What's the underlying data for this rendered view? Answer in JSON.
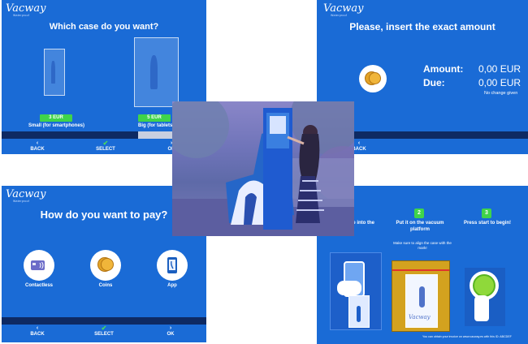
{
  "brand": {
    "name": "Vacway",
    "tagline": "Waterproof"
  },
  "nav": {
    "back": "BACK",
    "select": "SELECT",
    "ok": "OK",
    "ok_cut": "OK"
  },
  "case_screen": {
    "title": "Which case do you want?",
    "options": [
      {
        "price": "3 EUR",
        "label": "Small (for smartphones)"
      },
      {
        "price": "5 EUR",
        "label": "Big (for tablets)"
      }
    ]
  },
  "amount_screen": {
    "title": "Please, insert the exact amount",
    "amount_label": "Amount:",
    "amount_value": "0,00 EUR",
    "due_label": "Due:",
    "due_value": "0,00 EUR",
    "note": "No change given",
    "back": "BACK"
  },
  "payment_screen": {
    "title": "How do you want to pay?",
    "options": [
      {
        "label": "Contactless",
        "icon": "contactless-card-icon"
      },
      {
        "label": "Coins",
        "icon": "coins-icon"
      },
      {
        "label": "App",
        "icon": "phone-app-icon"
      }
    ]
  },
  "instructions_screen": {
    "steps": [
      {
        "num": "1",
        "text": "Put your device into the case"
      },
      {
        "num": "2",
        "text": "Put it on the vacuum platform"
      },
      {
        "num": "3",
        "text": "Press start to begin!"
      }
    ],
    "align_note": "Make sure to align the case with the mark!",
    "footer": "You can obtain your invoice on www.vacway.es with this ID: ABCDEF"
  },
  "colors": {
    "screen_blue": "#1a6bd6",
    "nav_dark": "#0e2a63",
    "accent_green": "#3fd44a",
    "coin_gold": "#e3a327"
  }
}
